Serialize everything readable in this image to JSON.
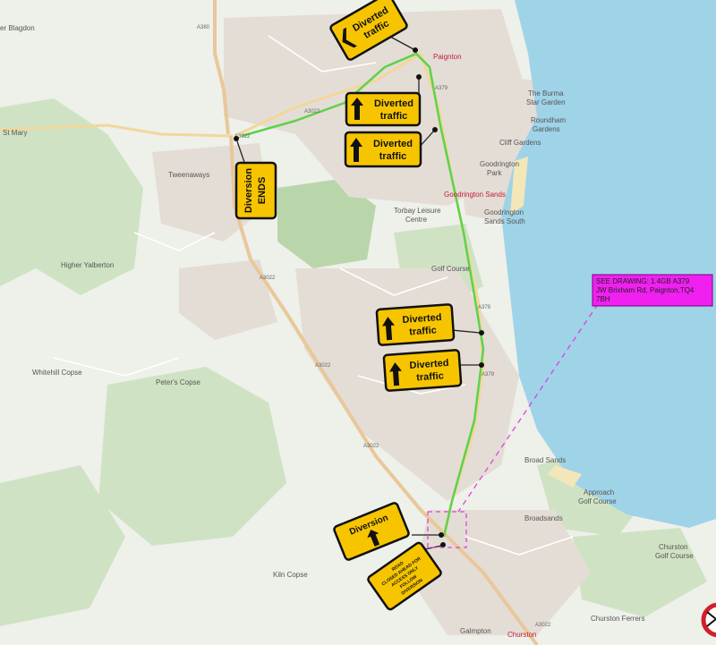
{
  "places": {
    "higher_blagdon": "er Blagdon",
    "st_mary": "St Mary",
    "tweenaways": "Tweenaways",
    "higher_yalberton": "Higher Yalberton",
    "whitehill_copse": "Whitehill Copse",
    "peters_copse": "Peter's Copse",
    "kiln_copse": "Kiln Copse",
    "paignton": "Paignton",
    "the_burma_star_garden_1": "The Burma",
    "the_burma_star_garden_2": "Star Garden",
    "roundham_gardens_1": "Roundham",
    "roundham_gardens_2": "Gardens",
    "cliff_gardens": "Cliff Gardens",
    "goodrington_park_1": "Goodrington",
    "goodrington_park_2": "Park",
    "goodrington_sands": "Goodrington Sands",
    "goodrington_sands_south_1": "Goodrington",
    "goodrington_sands_south_2": "Sands South",
    "torbay_leisure_1": "Torbay Leisure",
    "torbay_leisure_2": "Centre",
    "golf_course": "Golf Course",
    "broad_sands": "Broad Sands",
    "approach_golf_1": "Approach",
    "approach_golf_2": "Golf Course",
    "broadsands": "Broadsands",
    "churston_golf_1": "Churston",
    "churston_golf_2": "Golf Course",
    "churston_ferrers": "Churston Ferrers",
    "galmpton": "Galmpton",
    "churston": "Churston"
  },
  "roads": {
    "a380": "A380",
    "a3022_a": "A3022",
    "a3022_b": "A3022",
    "a3022_c": "A3022",
    "a3022_d": "A3022",
    "a3022_e": "A3022",
    "a379_a": "A379",
    "a379_b": "A379",
    "a379_c": "A379",
    "a3022_f": "A3022"
  },
  "signs": {
    "s1_line1": "Diverted",
    "s1_line2": "traffic",
    "s2_line1": "Diverted",
    "s2_line2": "traffic",
    "s3_line1": "Diverted",
    "s3_line2": "traffic",
    "s4_line1": "Diversion",
    "s4_line2": "ENDS",
    "s5_line1": "Diverted",
    "s5_line2": "traffic",
    "s6_line1": "Diverted",
    "s6_line2": "traffic",
    "s7_line1": "Diversion",
    "s8_line1": "ROAD",
    "s8_line2": "CLOSED AHEAD FOR",
    "s8_line3": "ACCESS ONLY",
    "s8_line4": "FOLLOW",
    "s8_line5": "DIVERSION"
  },
  "note": {
    "line1": "SEE DRAWING: 1.4GB A379",
    "line2": "JW Brixham Rd, Paignton,TQ4",
    "line3": "7BH"
  },
  "colors": {
    "sea": "#9fd3e8",
    "diversion_route": "#5fd24a",
    "sign_yellow": "#f7c500",
    "note_magenta": "#f020f0"
  }
}
